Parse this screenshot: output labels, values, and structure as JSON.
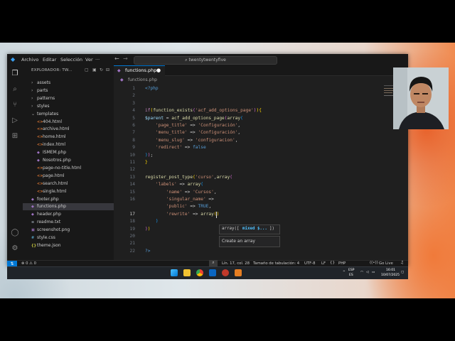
{
  "titlebar": {
    "menus": [
      "Archivo",
      "Editar",
      "Selección",
      "Ver",
      "···"
    ],
    "command_center": "twentytwentyfive"
  },
  "sidebar": {
    "header": "EXPLORADOR: TW...",
    "items": [
      {
        "label": "assets",
        "type": "folder",
        "depth": 1
      },
      {
        "label": "parts",
        "type": "folder",
        "depth": 1
      },
      {
        "label": "patterns",
        "type": "folder",
        "depth": 1
      },
      {
        "label": "styles",
        "type": "folder",
        "depth": 1
      },
      {
        "label": "templates",
        "type": "folder-open",
        "depth": 1
      },
      {
        "label": "404.html",
        "type": "html",
        "depth": 2
      },
      {
        "label": "archive.html",
        "type": "html",
        "depth": 2
      },
      {
        "label": "home.html",
        "type": "html",
        "depth": 2
      },
      {
        "label": "index.html",
        "type": "html",
        "depth": 2
      },
      {
        "label": "ISMEM.php",
        "type": "php",
        "depth": 2
      },
      {
        "label": "Nosotros.php",
        "type": "php",
        "depth": 2
      },
      {
        "label": "page-no-title.html",
        "type": "html",
        "depth": 2
      },
      {
        "label": "page.html",
        "type": "html",
        "depth": 2
      },
      {
        "label": "search.html",
        "type": "html",
        "depth": 2
      },
      {
        "label": "single.html",
        "type": "html",
        "depth": 2
      },
      {
        "label": "footer.php",
        "type": "php",
        "depth": 1
      },
      {
        "label": "functions.php",
        "type": "php",
        "depth": 1,
        "active": true
      },
      {
        "label": "header.php",
        "type": "php",
        "depth": 1
      },
      {
        "label": "readme.txt",
        "type": "txt",
        "depth": 1
      },
      {
        "label": "screenshot.png",
        "type": "png",
        "depth": 1
      },
      {
        "label": "style.css",
        "type": "css",
        "depth": 1
      },
      {
        "label": "theme.json",
        "type": "json",
        "depth": 1
      }
    ]
  },
  "editor": {
    "tab_label": "functions.php",
    "breadcrumb": "functions.php",
    "lines": [
      {
        "n": "1",
        "tokens": [
          [
            "tag",
            "<?php"
          ]
        ]
      },
      {
        "n": "2",
        "tokens": []
      },
      {
        "n": "3",
        "tokens": []
      },
      {
        "n": "4",
        "tokens": [
          [
            "k",
            "if"
          ],
          [
            "br1",
            "("
          ],
          [
            "f",
            "function_exists"
          ],
          [
            "br2",
            "("
          ],
          [
            "s",
            "'acf_add_options_page'"
          ],
          [
            "br2",
            ")"
          ],
          [
            "br1",
            ")"
          ],
          [
            "br1",
            "{"
          ]
        ]
      },
      {
        "n": "5",
        "tokens": [
          [
            "v",
            "$parent"
          ],
          [
            "p",
            " = "
          ],
          [
            "f",
            "acf_add_options_page"
          ],
          [
            "br2",
            "("
          ],
          [
            "f",
            "array"
          ],
          [
            "br3",
            "("
          ]
        ]
      },
      {
        "n": "6",
        "tokens": [
          [
            "p",
            "    "
          ],
          [
            "s",
            "'page_title'"
          ],
          [
            "p",
            " => "
          ],
          [
            "s",
            "'Configuración'"
          ],
          [
            "p",
            ","
          ]
        ]
      },
      {
        "n": "7",
        "tokens": [
          [
            "p",
            "    "
          ],
          [
            "s",
            "'menu_title'"
          ],
          [
            "p",
            " => "
          ],
          [
            "s",
            "'Configuración'"
          ],
          [
            "p",
            ","
          ]
        ]
      },
      {
        "n": "8",
        "tokens": [
          [
            "p",
            "    "
          ],
          [
            "s",
            "'menu_slug'"
          ],
          [
            "p",
            " => "
          ],
          [
            "s",
            "'configuracion'"
          ],
          [
            "p",
            ","
          ]
        ]
      },
      {
        "n": "9",
        "tokens": [
          [
            "p",
            "    "
          ],
          [
            "s",
            "'redirect'"
          ],
          [
            "p",
            " => "
          ],
          [
            "b",
            "false"
          ]
        ]
      },
      {
        "n": "10",
        "tokens": [
          [
            "br3",
            ")"
          ],
          [
            "br2",
            ")"
          ],
          [
            "p",
            ";"
          ]
        ]
      },
      {
        "n": "11",
        "tokens": [
          [
            "br1",
            "}"
          ]
        ]
      },
      {
        "n": "12",
        "tokens": []
      },
      {
        "n": "13",
        "tokens": [
          [
            "f",
            "register_post_type"
          ],
          [
            "br1",
            "("
          ],
          [
            "s",
            "'curso'"
          ],
          [
            "p",
            ","
          ],
          [
            "f",
            "array"
          ],
          [
            "br2",
            "("
          ]
        ]
      },
      {
        "n": "14",
        "tokens": [
          [
            "p",
            "    "
          ],
          [
            "s",
            "'labels'"
          ],
          [
            "p",
            " => "
          ],
          [
            "f",
            "array"
          ],
          [
            "br3",
            "("
          ]
        ]
      },
      {
        "n": "15",
        "tokens": [
          [
            "p",
            "        "
          ],
          [
            "s",
            "'name'"
          ],
          [
            "p",
            " => "
          ],
          [
            "s",
            "'Cursos'"
          ],
          [
            "p",
            ","
          ]
        ]
      },
      {
        "n": "16",
        "tokens": [
          [
            "p",
            "        "
          ],
          [
            "s",
            "'singular_name'"
          ],
          [
            "p",
            " =>"
          ]
        ]
      },
      {
        "n": "16b",
        "tokens": [
          [
            "p",
            "        "
          ],
          [
            "s",
            "'public'"
          ],
          [
            "p",
            " => "
          ],
          [
            "b",
            "TRUE"
          ],
          [
            "p",
            ","
          ]
        ]
      },
      {
        "n": "17",
        "tokens": [
          [
            "p",
            "        "
          ],
          [
            "s",
            "'rewrite'"
          ],
          [
            "p",
            " => "
          ],
          [
            "f",
            "array"
          ],
          [
            "br1",
            "()"
          ]
        ],
        "current": true
      },
      {
        "n": "18",
        "tokens": [
          [
            "p",
            "    "
          ],
          [
            "br3",
            ")"
          ]
        ]
      },
      {
        "n": "19",
        "tokens": [
          [
            "br2",
            ")"
          ],
          [
            "br1",
            ")"
          ]
        ]
      },
      {
        "n": "20",
        "tokens": []
      },
      {
        "n": "21",
        "tokens": []
      },
      {
        "n": "22",
        "tokens": [
          [
            "tag",
            "?>"
          ]
        ]
      }
    ],
    "param_hint": {
      "prefix": "array([ ",
      "param": "mixed $...",
      "suffix": " ])"
    },
    "suggestion": "Create an array"
  },
  "statusbar": {
    "problems": "⊗ 0 ⚠ 0",
    "position": "Lín. 17, col. 28",
    "tab_size": "Tamaño de tabulación: 4",
    "encoding": "UTF-8",
    "eol": "LF",
    "language": "PHP",
    "go_live": "Go Live"
  },
  "taskbar": {
    "lang_top": "ESP",
    "lang_bottom": "ES",
    "time": "16:01",
    "date": "10/07/2025"
  },
  "colors": {
    "accent": "#0078d4",
    "editor_bg": "#1f1f1f",
    "sidebar_bg": "#181818"
  }
}
